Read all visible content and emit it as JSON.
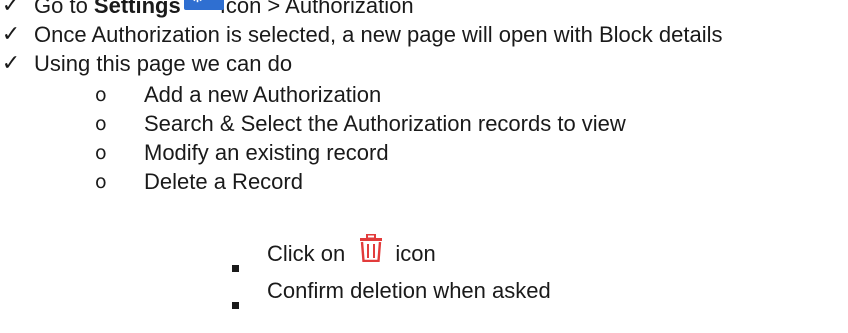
{
  "items": [
    {
      "bullet": "✓",
      "pre": "Go to ",
      "bold": "Settings",
      "post": "Icon > Authorization"
    },
    {
      "bullet": "✓",
      "text": "Once Authorization is selected, a new page will open with Block details"
    },
    {
      "bullet": "✓",
      "text": "Using this page we can do"
    }
  ],
  "sub_items": [
    {
      "bullet": "o",
      "text": "Add a new Authorization"
    },
    {
      "bullet": "o",
      "text": "Search & Select the Authorization records to view"
    },
    {
      "bullet": "o",
      "text": "Modify an existing record"
    },
    {
      "bullet": "o",
      "text": "Delete a Record"
    }
  ],
  "sub_sub_items": [
    {
      "pre": "Click on ",
      "post": "icon"
    },
    {
      "text": "Confirm deletion when asked"
    }
  ],
  "icons": {
    "settings": "gear-dropdown-icon",
    "delete": "trash-icon"
  },
  "colors": {
    "settings_button": "#2f6fd1",
    "trash_icon": "#e23b3b",
    "text": "#1a1a1a"
  }
}
